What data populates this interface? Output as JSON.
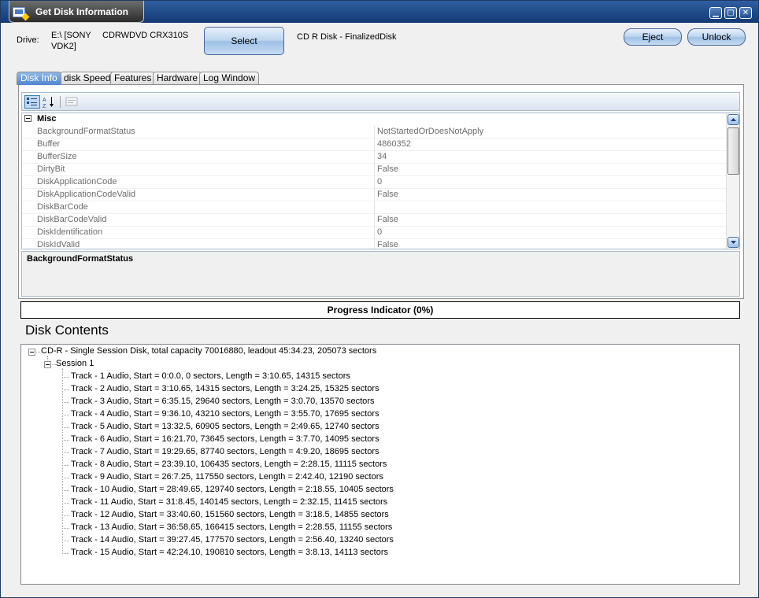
{
  "window": {
    "title": "Get Disk Information",
    "controls": {
      "minimize": "▁",
      "maximize": "▢",
      "close": "✕"
    }
  },
  "drive": {
    "label": "Drive:",
    "path_line1": "E:\\ [SONY",
    "path_line2": "VDK2]",
    "model": "CDRWDVD CRX310S",
    "select_button": "Select",
    "disk_status": "CD R Disk - FinalizedDisk",
    "eject_button": "Eject",
    "unlock_button": "Unlock"
  },
  "tabs": [
    {
      "label": "Disk Info",
      "active": true
    },
    {
      "label": "disk Speed",
      "active": false
    },
    {
      "label": "Features",
      "active": false
    },
    {
      "label": "Hardware",
      "active": false
    },
    {
      "label": "Log Window",
      "active": false
    }
  ],
  "property_grid": {
    "toolbar_icons": [
      "categorized-icon",
      "alphabetical-sort-icon",
      "property-pages-icon"
    ],
    "category": {
      "label": "Misc",
      "expander": "⊟"
    },
    "rows": [
      {
        "name": "BackgroundFormatStatus",
        "value": "NotStartedOrDoesNotApply"
      },
      {
        "name": "Buffer",
        "value": "4860352"
      },
      {
        "name": "BufferSize",
        "value": "34"
      },
      {
        "name": "DirtyBit",
        "value": "False"
      },
      {
        "name": "DiskApplicationCode",
        "value": "0"
      },
      {
        "name": "DiskApplicationCodeValid",
        "value": "False"
      },
      {
        "name": "DiskBarCode",
        "value": ""
      },
      {
        "name": "DiskBarCodeValid",
        "value": "False"
      },
      {
        "name": "DiskIdentification",
        "value": "0"
      },
      {
        "name": "DiskIdValid",
        "value": "False"
      }
    ],
    "description_title": "BackgroundFormatStatus"
  },
  "progress": {
    "text": "Progress Indicator (0%)",
    "value": 0
  },
  "disk_contents": {
    "title": "Disk Contents",
    "root": "CD-R - Single Session Disk, total capacity 70016880, leadout 45:34.23, 205073 sectors",
    "session": "Session 1",
    "tracks": [
      "Track - 1  Audio, Start = 0:0.0, 0 sectors, Length = 3:10.65, 14315 sectors",
      "Track - 2  Audio, Start = 3:10.65, 14315 sectors, Length = 3:24.25, 15325 sectors",
      "Track - 3  Audio, Start = 6:35.15, 29640 sectors, Length = 3:0.70, 13570 sectors",
      "Track - 4  Audio, Start = 9:36.10, 43210 sectors, Length = 3:55.70, 17695 sectors",
      "Track - 5  Audio, Start = 13:32.5, 60905 sectors, Length = 2:49.65, 12740 sectors",
      "Track - 6  Audio, Start = 16:21.70, 73645 sectors, Length = 3:7.70, 14095 sectors",
      "Track - 7  Audio, Start = 19:29.65, 87740 sectors, Length = 4:9.20, 18695 sectors",
      "Track - 8  Audio, Start = 23:39.10, 106435 sectors, Length = 2:28.15, 11115 sectors",
      "Track - 9  Audio, Start = 26:7.25, 117550 sectors, Length = 2:42.40, 12190 sectors",
      "Track - 10  Audio, Start = 28:49.65, 129740 sectors, Length = 2:18.55, 10405 sectors",
      "Track - 11  Audio, Start = 31:8.45, 140145 sectors, Length = 2:32.15, 11415 sectors",
      "Track - 12  Audio, Start = 33:40.60, 151560 sectors, Length = 3:18.5, 14855 sectors",
      "Track - 13  Audio, Start = 36:58.65, 166415 sectors, Length = 2:28.55, 11155 sectors",
      "Track - 14  Audio, Start = 39:27.45, 177570 sectors, Length = 2:56.40, 13240 sectors",
      "Track - 15  Audio, Start = 42:24.10, 190810 sectors, Length = 3:8.13, 14113 sectors"
    ]
  }
}
